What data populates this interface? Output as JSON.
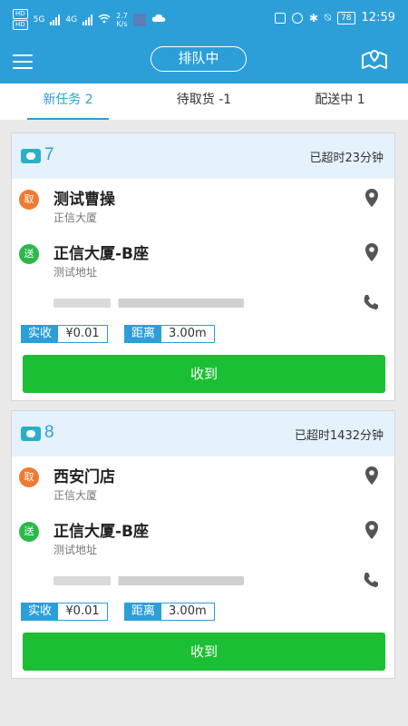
{
  "statusbar": {
    "hd1": "HD",
    "hd2": "HD",
    "net1": "5G",
    "net2": "4G",
    "speed_value": "2.7",
    "speed_unit": "K/s",
    "battery": "78",
    "time": "12:59"
  },
  "header": {
    "queue_label": "排队中"
  },
  "tabs": [
    {
      "label": "新任务 2"
    },
    {
      "label": "待取货 -1"
    },
    {
      "label": "配送中 1"
    }
  ],
  "orders": [
    {
      "number": "7",
      "overtime": "已超时23分钟",
      "pickup_badge": "取",
      "pickup_name": "测试曹操",
      "pickup_address": "正信大厦",
      "deliver_badge": "送",
      "deliver_name": "正信大厦-B座",
      "deliver_address": "测试地址",
      "received_label": "实收",
      "received_value": "¥0.01",
      "distance_label": "距离",
      "distance_value": "3.00m",
      "button": "收到"
    },
    {
      "number": "8",
      "overtime": "已超时1432分钟",
      "pickup_badge": "取",
      "pickup_name": "西安门店",
      "pickup_address": "正信大厦",
      "deliver_badge": "送",
      "deliver_name": "正信大厦-B座",
      "deliver_address": "测试地址",
      "received_label": "实收",
      "received_value": "¥0.01",
      "distance_label": "距离",
      "distance_value": "3.00m",
      "button": "收到"
    }
  ],
  "colors": {
    "primary": "#2c9fd9",
    "pickup_badge": "#f07a30",
    "deliver_badge": "#2bb84a",
    "confirm_button": "#1bbf33"
  },
  "icons": {
    "menu": "menu-icon",
    "map": "map-pin-icon",
    "pin": "location-pin-icon",
    "phone": "phone-icon",
    "order": "message-icon"
  }
}
